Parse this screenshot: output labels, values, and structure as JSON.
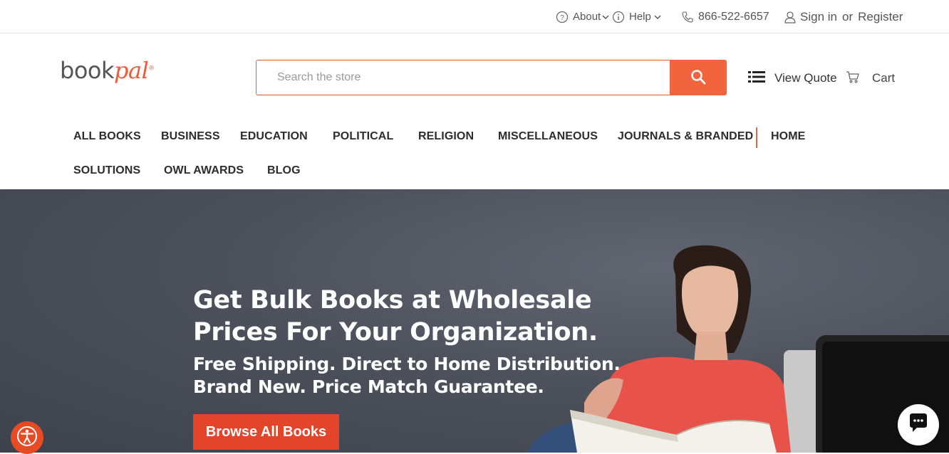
{
  "utility": {
    "about": "About",
    "help": "Help",
    "phone": "866-522-6657",
    "sign_in": "Sign in",
    "or": "or",
    "register": "Register"
  },
  "header": {
    "logo_main": "book",
    "logo_accent": "pal",
    "logo_mark": "®",
    "search_placeholder": "Search the store",
    "view_quote": "View Quote",
    "cart": "Cart"
  },
  "nav": {
    "items": [
      "ALL BOOKS",
      "BUSINESS",
      "EDUCATION",
      "POLITICAL",
      "RELIGION",
      "MISCELLANEOUS",
      "JOURNALS & BRANDED",
      "HOME",
      "SOLUTIONS",
      "OWL AWARDS",
      "BLOG"
    ]
  },
  "hero": {
    "headline_line1": "Get Bulk Books at Wholesale",
    "headline_line2": "Prices For Your Organization.",
    "sub_line1": "Free Shipping. Direct to Home Distribution.",
    "sub_line2": "Brand New. Price Match Guarantee.",
    "cta": "Browse All Books"
  },
  "colors": {
    "accent": "#f1643d",
    "cta": "#e2452a",
    "hero_bg": "#4d515c"
  },
  "icons": [
    "question-circle-icon",
    "info-circle-icon",
    "chevron-down-icon",
    "phone-icon",
    "user-icon",
    "search-icon",
    "list-icon",
    "cart-icon",
    "accessibility-icon",
    "chat-icon"
  ]
}
